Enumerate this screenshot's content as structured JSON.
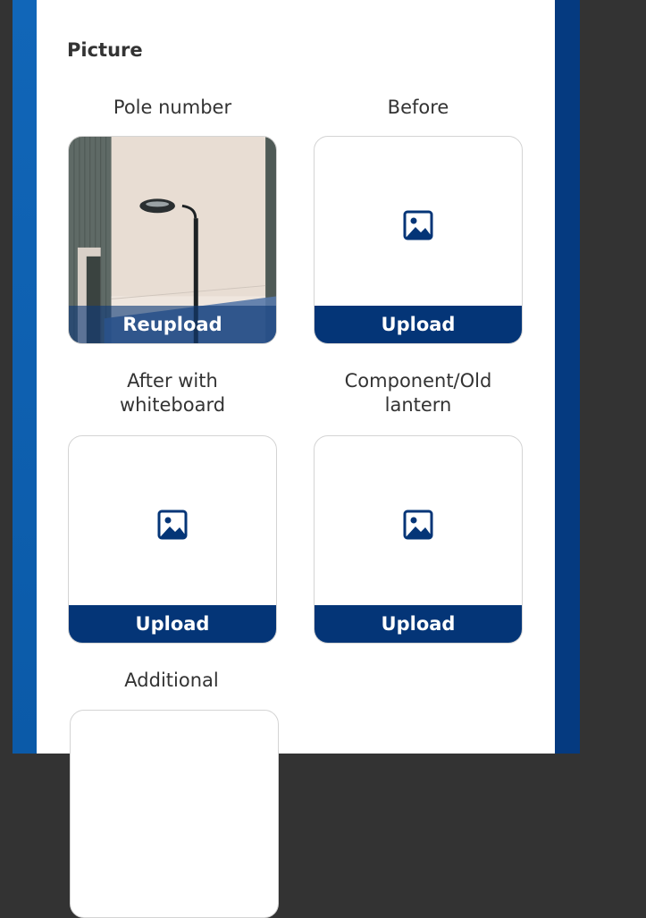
{
  "section": {
    "title": "Picture"
  },
  "slots": [
    {
      "label": "Pole number",
      "action": "Reupload",
      "has_photo": true
    },
    {
      "label": "Before",
      "action": "Upload",
      "has_photo": false
    },
    {
      "label": "After with whiteboard",
      "label_line1": "After with",
      "label_line2": "whiteboard",
      "action": "Upload",
      "has_photo": false
    },
    {
      "label": "Component/Old lantern",
      "label_line1": "Component/Old",
      "label_line2": "lantern",
      "action": "Upload",
      "has_photo": false
    },
    {
      "label": "Additional",
      "has_photo": false
    }
  ],
  "icons": {
    "placeholder": "image-icon"
  },
  "colors": {
    "brand_dark": "#043577",
    "brand_blue": "#1166b8",
    "text": "#333333",
    "background": "#333333"
  }
}
